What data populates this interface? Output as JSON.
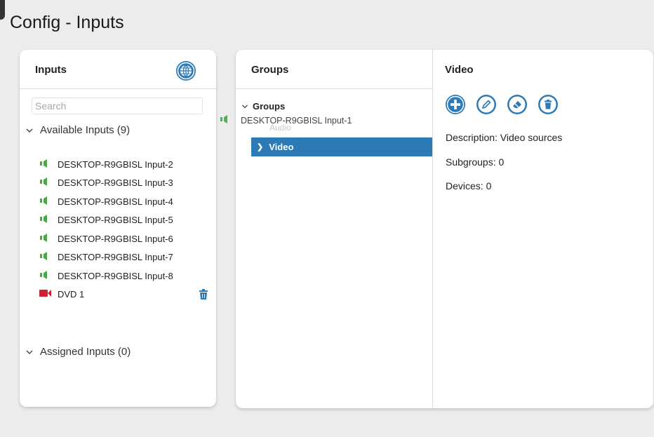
{
  "page": {
    "title": "Config - Inputs"
  },
  "inputs_panel": {
    "title": "Inputs",
    "globe_icon": "globe-icon",
    "search": {
      "placeholder": "Search",
      "value": ""
    },
    "available_label": "Available Inputs (9)",
    "assigned_label": "Assigned Inputs (0)",
    "items": [
      {
        "label": "DESKTOP-R9GBISL Input-2",
        "icon": "audio-speaker-icon"
      },
      {
        "label": "DESKTOP-R9GBISL Input-3",
        "icon": "audio-speaker-icon"
      },
      {
        "label": "DESKTOP-R9GBISL Input-4",
        "icon": "audio-speaker-icon"
      },
      {
        "label": "DESKTOP-R9GBISL Input-5",
        "icon": "audio-speaker-icon"
      },
      {
        "label": "DESKTOP-R9GBISL Input-6",
        "icon": "audio-speaker-icon"
      },
      {
        "label": "DESKTOP-R9GBISL Input-7",
        "icon": "audio-speaker-icon"
      },
      {
        "label": "DESKTOP-R9GBISL Input-8",
        "icon": "audio-speaker-icon"
      },
      {
        "label": "DVD 1",
        "icon": "video-camera-icon"
      }
    ]
  },
  "groups_panel": {
    "title": "Groups",
    "tree": {
      "root_label": "Groups",
      "audio_label": "Audio",
      "video_label": "Video"
    },
    "drag_ghost_label": "DESKTOP-R9GBISL Input-1"
  },
  "video_panel": {
    "title": "Video",
    "actions": [
      "add-circle-icon",
      "edit-pencil-icon",
      "eraser-icon",
      "delete-trash-icon"
    ],
    "description": "Description: Video sources",
    "subgroups": "Subgroups: 0",
    "devices": "Devices: 0"
  },
  "colors": {
    "accent": "#2c7ab6",
    "audio_green": "#4aa84a",
    "video_red": "#d0202f",
    "background": "#ececec"
  }
}
